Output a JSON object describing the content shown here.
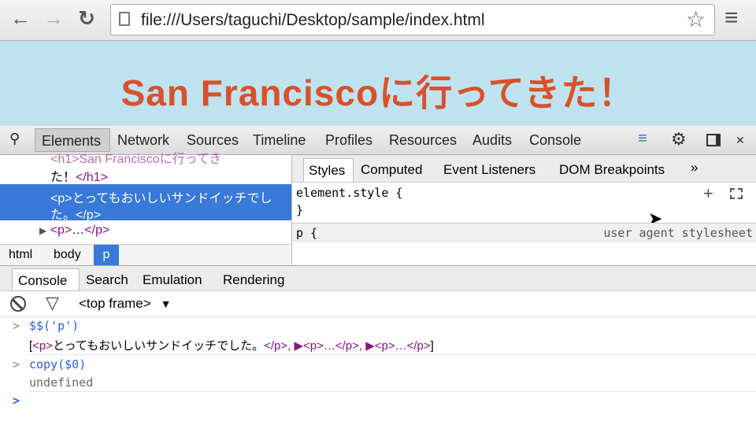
{
  "browser": {
    "url": "file:///Users/taguchi/Desktop/sample/index.html",
    "back": "←",
    "forward": "→",
    "reload": "↻",
    "star": "☆",
    "menu": "≡"
  },
  "page": {
    "heading": "San Franciscoに行ってきた！"
  },
  "devtools": {
    "tabs": [
      "Elements",
      "Network",
      "Sources",
      "Timeline",
      "Profiles",
      "Resources",
      "Audits",
      "Console"
    ],
    "active_tab": "Elements"
  },
  "elements": {
    "line0": "<h1>San Franciscoに行ってき",
    "line1_text": "た！",
    "line1_tag": "</h1>",
    "sel_line1": "<p>とってもおいしいサンドイッチでし",
    "sel_line2": "た。</p>",
    "collapsed_open": "<p>",
    "collapsed_ellipsis": "…",
    "collapsed_close": "</p>",
    "breadcrumbs": [
      "html",
      "body",
      "p"
    ]
  },
  "styles": {
    "tabs": [
      "Styles",
      "Computed",
      "Event Listeners",
      "DOM Breakpoints"
    ],
    "more": "»",
    "element_style": "element.style {",
    "close_brace": "}",
    "rule_selector": "p {",
    "rule_source": "user agent stylesheet"
  },
  "drawer": {
    "tabs": [
      "Console",
      "Search",
      "Emulation",
      "Rendering"
    ]
  },
  "console": {
    "frame": "<top frame>",
    "cmd1": "$$('p')",
    "result1_open": "[",
    "result1_tag": "<p>",
    "result1_text": "とってもおいしいサンドイッチでした。",
    "result1_close": "</p>",
    "result1_rest": ", ▶<p>…</p>, ▶<p>…</p>",
    "result1_end": "]",
    "cmd2": "copy($0)",
    "result2": "undefined"
  }
}
